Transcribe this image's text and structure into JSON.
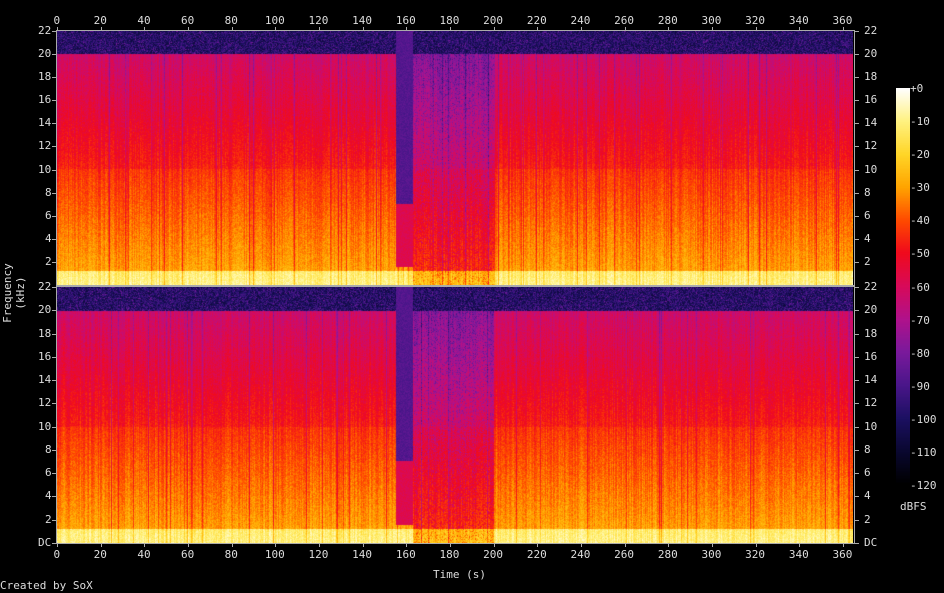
{
  "chart_data": {
    "type": "heatmap",
    "title": "",
    "xlabel": "Time (s)",
    "ylabel": "Frequency (kHz)",
    "x_ticks": [
      0,
      20,
      40,
      60,
      80,
      100,
      120,
      140,
      160,
      180,
      200,
      220,
      240,
      260,
      280,
      300,
      320,
      340,
      360
    ],
    "xlim": [
      0,
      375
    ],
    "y_ticks_top": [
      "2",
      "4",
      "6",
      "8",
      "10",
      "12",
      "14",
      "16",
      "18",
      "20",
      "22"
    ],
    "y_ticks_bottom": [
      "DC",
      "2",
      "4",
      "6",
      "8",
      "10",
      "12",
      "14",
      "16",
      "18",
      "20",
      "22"
    ],
    "ylim_khz": [
      0,
      22
    ],
    "channels": 2,
    "lowpass_cutoff_khz": 20,
    "quiet_section_s": [
      155,
      163
    ],
    "reduced_level_section_s": [
      163,
      200
    ],
    "colorbar": {
      "label": "dBFS",
      "ticks": [
        "+0",
        "-10",
        "-20",
        "-30",
        "-40",
        "-50",
        "-60",
        "-70",
        "-80",
        "-90",
        "-100",
        "-110",
        "-120"
      ],
      "range_db": [
        -120,
        0
      ],
      "stops": [
        {
          "db": -120,
          "color": "#000000"
        },
        {
          "db": -110,
          "color": "#0a0830"
        },
        {
          "db": -100,
          "color": "#1c1062"
        },
        {
          "db": -90,
          "color": "#4a168a"
        },
        {
          "db": -80,
          "color": "#7a1a9c"
        },
        {
          "db": -70,
          "color": "#b0128c"
        },
        {
          "db": -60,
          "color": "#d80a5a"
        },
        {
          "db": -50,
          "color": "#f00a1e"
        },
        {
          "db": -40,
          "color": "#ff4a00"
        },
        {
          "db": -30,
          "color": "#ffa400"
        },
        {
          "db": -20,
          "color": "#ffd628"
        },
        {
          "db": -10,
          "color": "#fff280"
        },
        {
          "db": 0,
          "color": "#ffffff"
        }
      ]
    }
  },
  "footer": {
    "credit": "Created by SoX"
  }
}
